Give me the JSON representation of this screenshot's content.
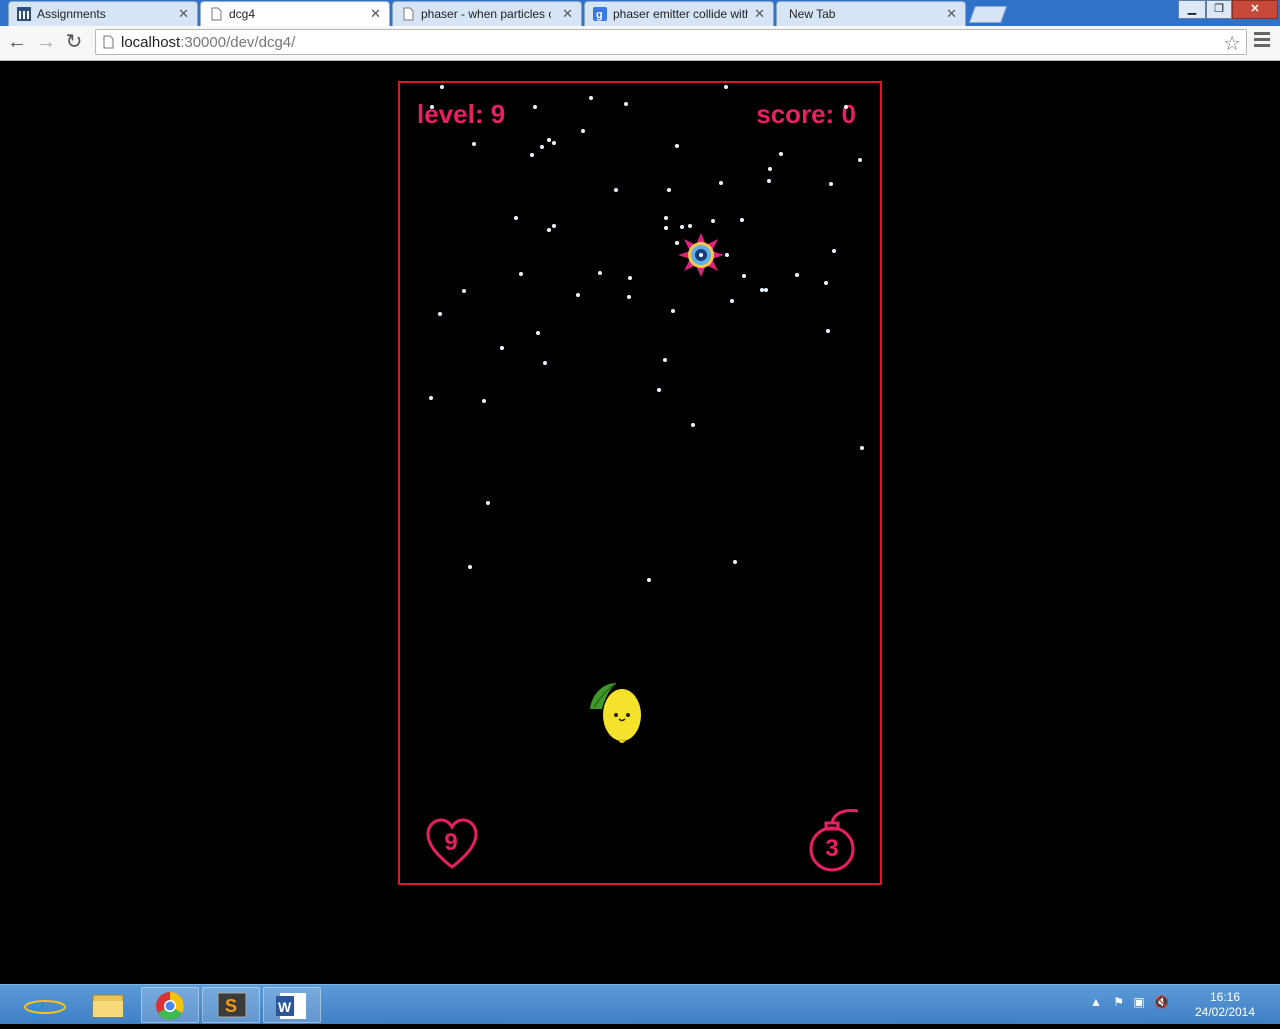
{
  "browser": {
    "tabs": [
      {
        "label": "Assignments",
        "icon": "moodle-icon",
        "active": false
      },
      {
        "label": "dcg4",
        "icon": "page-icon",
        "active": true
      },
      {
        "label": "phaser - when particles co",
        "icon": "page-icon",
        "active": false
      },
      {
        "label": "phaser emitter collide with",
        "icon": "google-icon",
        "active": false
      },
      {
        "label": "New Tab",
        "icon": "none",
        "active": false
      }
    ],
    "url_host": "localhost",
    "url_path": ":30000/dev/dcg4/"
  },
  "game": {
    "level_label": "level: 9",
    "score_label": "score: 0",
    "lives": "9",
    "bombs": "3",
    "accent_color": "#ea1e63",
    "border_color": "#e3151f"
  },
  "taskbar": {
    "apps": [
      "internet-explorer-icon",
      "file-explorer-icon",
      "chrome-icon",
      "sublime-text-icon",
      "word-icon"
    ],
    "time": "16:16",
    "date": "24/02/2014"
  }
}
